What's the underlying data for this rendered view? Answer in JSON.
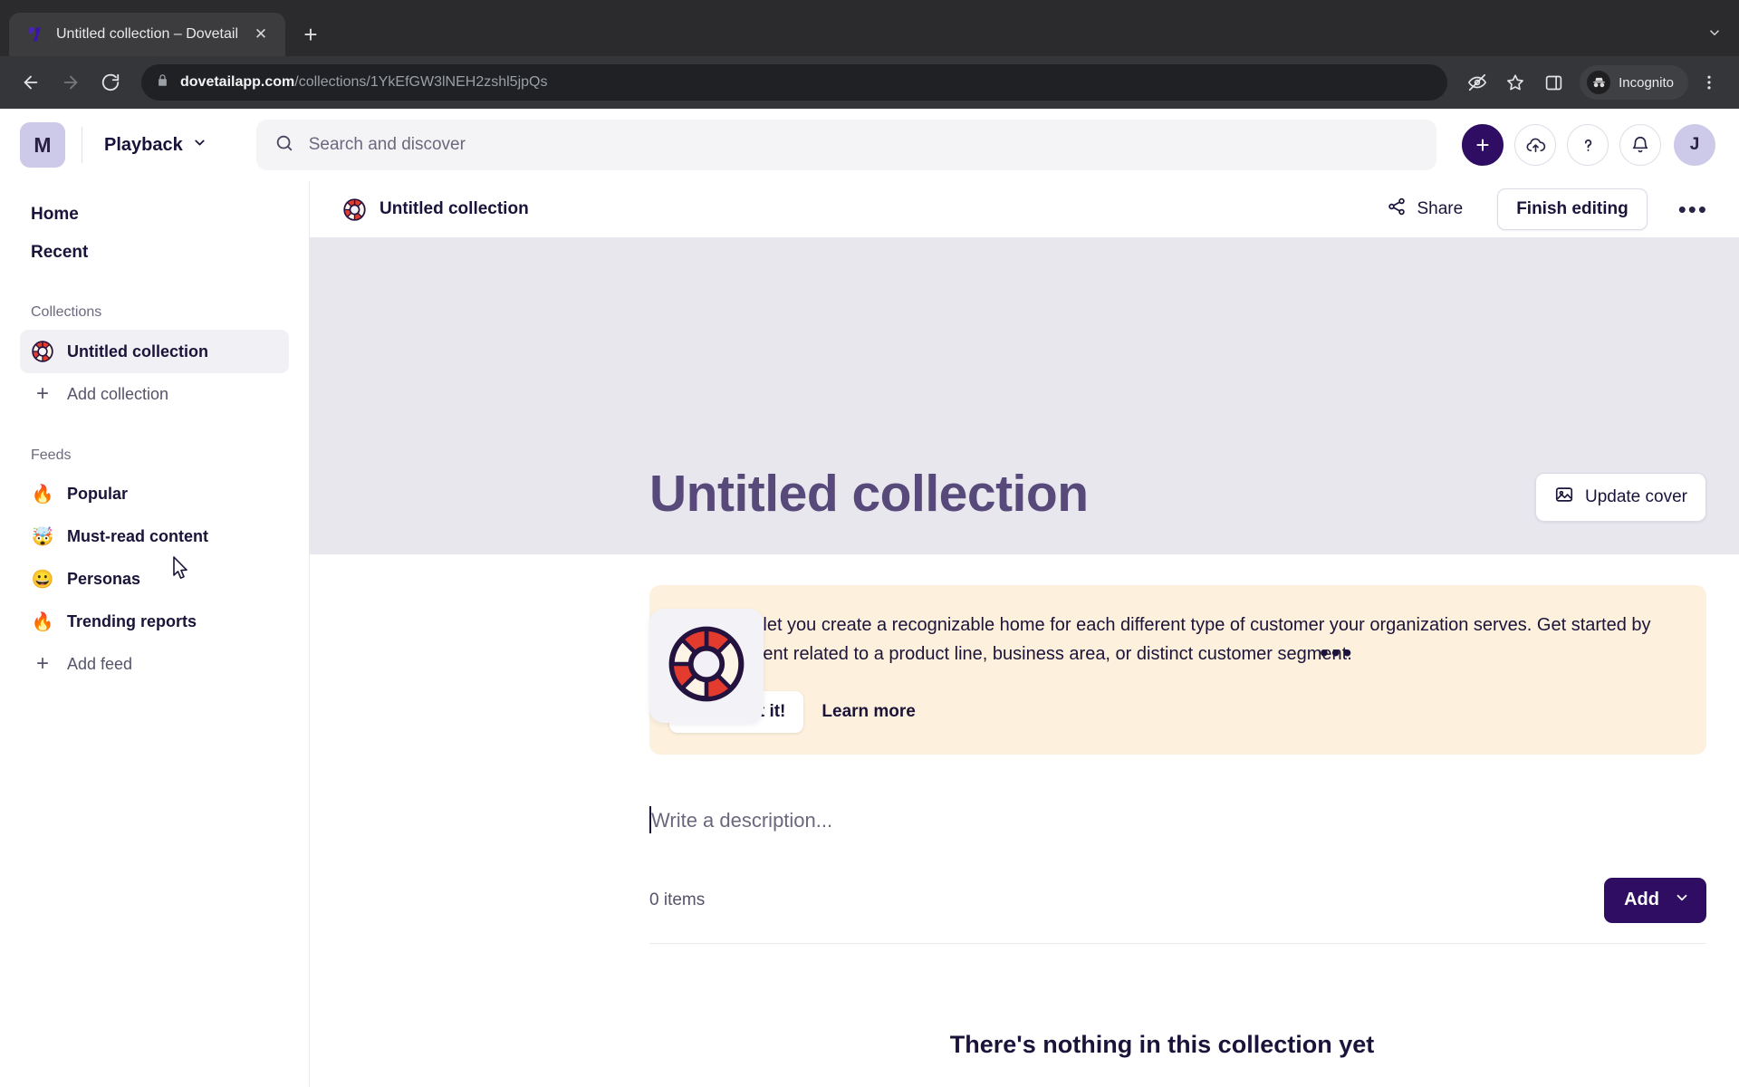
{
  "browser": {
    "tab": {
      "title": "Untitled collection – Dovetail",
      "favicon_icon": "dovetail-logo-icon",
      "close_icon": "close-icon"
    },
    "new_tab_icon": "plus-icon",
    "tabstrip_menu_icon": "chevron-down-icon",
    "toolbar": {
      "back_icon": "back-arrow-icon",
      "forward_icon": "forward-arrow-icon",
      "reload_icon": "reload-icon",
      "lock_icon": "lock-icon",
      "url_domain": "dovetailapp.com",
      "url_path": "/collections/1YkEfGW3lNEH2zshl5jpQs",
      "tracking_icon": "eye-slash-icon",
      "bookmark_icon": "star-icon",
      "side_panel_icon": "side-panel-icon",
      "incognito_label": "Incognito",
      "incognito_icon": "incognito-hat-icon",
      "menu_icon": "kebab-menu-icon"
    }
  },
  "header": {
    "workspace_initial": "M",
    "product_menu_label": "Playback",
    "product_menu_icon": "chevron-down-icon",
    "search": {
      "placeholder": "Search and discover",
      "icon": "search-icon"
    },
    "create_icon": "plus-icon",
    "upload_icon": "upload-cloud-icon",
    "help_icon": "question-mark-icon",
    "notifications_icon": "bell-icon",
    "user_initial": "J"
  },
  "sidebar": {
    "top_items": [
      {
        "label": "Home",
        "name": "sidebar-item-home"
      },
      {
        "label": "Recent",
        "name": "sidebar-item-recent"
      }
    ],
    "collections_label": "Collections",
    "collections": [
      {
        "label": "Untitled collection",
        "icon": "life-ring-icon",
        "active": true
      }
    ],
    "add_collection_label": "Add collection",
    "feeds_label": "Feeds",
    "feeds": [
      {
        "label": "Popular",
        "emoji": "🔥"
      },
      {
        "label": "Must-read content",
        "emoji": "🤯"
      },
      {
        "label": "Personas",
        "emoji": "😀"
      },
      {
        "label": "Trending reports",
        "emoji": "🔥"
      }
    ],
    "add_feed_label": "Add feed"
  },
  "collection": {
    "breadcrumb_label": "Untitled collection",
    "breadcrumb_icon": "life-ring-icon",
    "share_label": "Share",
    "share_icon": "share-nodes-icon",
    "finish_editing_label": "Finish editing",
    "more_icon": "ellipsis-icon",
    "cover_more_icon": "ellipsis-icon",
    "title": "Untitled collection",
    "icon": "life-ring-icon",
    "update_cover_label": "Update cover",
    "update_cover_icon": "image-icon",
    "banner": {
      "text": "Collections let you create a recognizable home for each different type of customer your organization serves. Get started by adding content related to a product line, business area, or distinct customer segment.",
      "primary_label": "Okay, got it!",
      "secondary_label": "Learn more"
    },
    "description_placeholder": "Write a description...",
    "items_count_label": "0 items",
    "add_label": "Add",
    "add_chevron_icon": "chevron-down-icon",
    "empty_title": "There's nothing in this collection yet"
  },
  "colors": {
    "brand_purple": "#2f0d62",
    "title_purple": "#574a7b",
    "banner_cream": "#fdf1dd",
    "cover_grey": "#e9e7ee"
  }
}
